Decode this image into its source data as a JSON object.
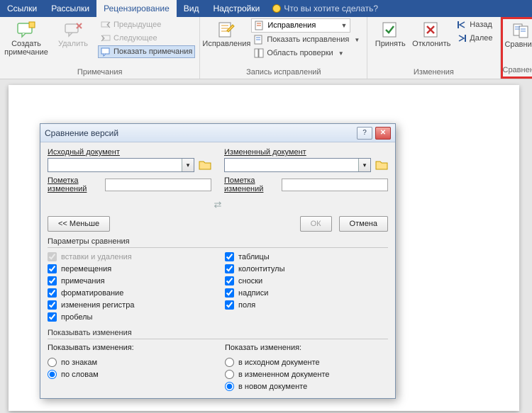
{
  "tabs": {
    "links": "Ссылки",
    "mailings": "Рассылки",
    "review": "Рецензирование",
    "view": "Вид",
    "addins": "Надстройки",
    "tellme": "Что вы хотите сделать?"
  },
  "ribbon": {
    "comments": {
      "new": "Создать примечание",
      "delete": "Удалить",
      "prev": "Предыдущее",
      "next": "Следующее",
      "show": "Показать примечания",
      "group": "Примечания"
    },
    "tracking": {
      "track": "Исправления",
      "display_combo": "Исправления",
      "show_markup": "Показать исправления",
      "review_pane": "Область проверки",
      "group": "Запись исправлений"
    },
    "changes": {
      "accept": "Принять",
      "reject": "Отклонить",
      "back": "Назад",
      "forward": "Далее",
      "group": "Изменения"
    },
    "compare": {
      "compare": "Сравнить",
      "group": "Сравнение"
    }
  },
  "dialog": {
    "title": "Сравнение версий",
    "orig_label": "Исходный документ",
    "rev_label": "Измененный документ",
    "mark_label_l": "Пометка изменений",
    "mark_label_r": "Пометка изменений",
    "less": "<< Меньше",
    "ok": "ОК",
    "cancel": "Отмена",
    "params_title": "Параметры сравнения",
    "checks_left": {
      "insdel": "вставки и удаления",
      "moves": "перемещения",
      "comments": "примечания",
      "formatting": "форматирование",
      "case": "изменения регистра",
      "whitespace": "пробелы"
    },
    "checks_right": {
      "tables": "таблицы",
      "headers": "колонтитулы",
      "footnotes": "сноски",
      "textboxes": "надписи",
      "fields": "поля"
    },
    "show_title": "Показывать изменения",
    "show_left_head": "Показывать изменения:",
    "show_left": {
      "by_char": "по знакам",
      "by_word": "по словам"
    },
    "show_right_head": "Показать изменения:",
    "show_right": {
      "in_orig": "в исходном документе",
      "in_rev": "в измененном документе",
      "in_new": "в новом документе"
    }
  }
}
